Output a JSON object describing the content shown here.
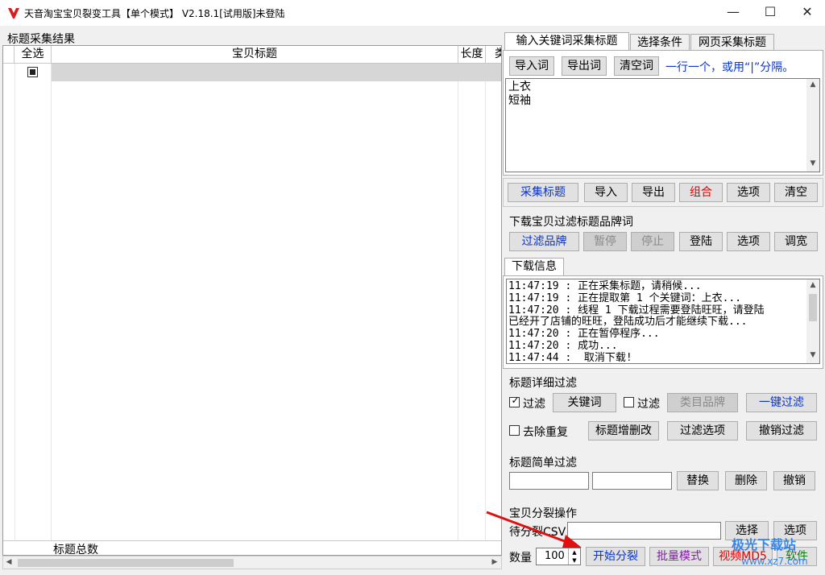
{
  "window": {
    "title": "天音淘宝宝贝裂变工具【单个模式】 V2.18.1[试用版]未登陆",
    "minimize": "—",
    "maximize": "☐",
    "close": "✕"
  },
  "grid": {
    "section_label": "标题采集结果",
    "headers": [
      "全选",
      "宝贝标题",
      "长度",
      "类"
    ],
    "footer_label": "标题总数"
  },
  "tabs": [
    "输入关键词采集标题",
    "选择条件",
    "网页采集标题"
  ],
  "keywords": {
    "import": "导入词",
    "export": "导出词",
    "clear": "清空词",
    "hint": "一行一个，或用“|”分隔。",
    "lines": [
      "上衣",
      "短袖"
    ]
  },
  "collect_bar": {
    "collect": "采集标题",
    "import": "导入",
    "export": "导出",
    "combine": "组合",
    "options": "选项",
    "clear": "清空"
  },
  "brand_filter": {
    "label": "下载宝贝过滤标题品牌词",
    "filter": "过滤品牌",
    "pause": "暂停",
    "stop": "停止",
    "login": "登陆",
    "options": "选项",
    "widen": "调宽"
  },
  "download_info": {
    "tab": "下载信息",
    "log": [
      "11:47:19 : 正在采集标题，请稍候...",
      "11:47:19 : 正在提取第 1 个关键词：上衣...",
      "11:47:20 : 线程 1 下载过程需要登陆旺旺，请登陆",
      "已经开了店铺的旺旺，登陆成功后才能继续下载...",
      "11:47:20 : 正在暂停程序...",
      "11:47:20 : 成功...",
      "11:47:44 :  取消下载!"
    ]
  },
  "detail_filter": {
    "label": "标题详细过滤",
    "filter1": "过滤",
    "keywords": "关键词",
    "filter2": "过滤",
    "category_brand": "类目品牌",
    "one_click": "一键过滤",
    "dedupe": "去除重复",
    "edit": "标题增删改",
    "filter_options": "过滤选项",
    "undo": "撤销过滤"
  },
  "simple_filter": {
    "label": "标题简单过滤",
    "replace": "替换",
    "delete": "删除",
    "undo": "撤销"
  },
  "split": {
    "label": "宝贝分裂操作",
    "csv_label": "待分裂CSV",
    "select": "选择",
    "options": "选项",
    "qty_label": "数量",
    "qty_value": "100",
    "start": "开始分裂",
    "batch": "批量模式",
    "video": "视频MD5",
    "software": "软件"
  },
  "watermark": {
    "cn": "极光下载站",
    "url": "www.xz7.com"
  }
}
